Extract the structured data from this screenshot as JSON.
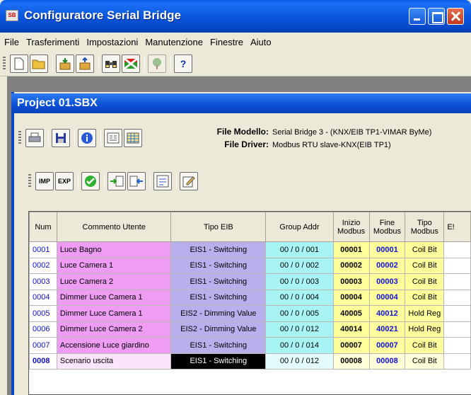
{
  "window": {
    "title": "Configuratore Serial Bridge",
    "app_icon": "SB"
  },
  "menu": [
    "File",
    "Trasferimenti",
    "Impostazioni",
    "Manutenzione",
    "Finestre",
    "Aiuto"
  ],
  "main_toolbar_icons": [
    "new-file-icon",
    "open-folder-icon",
    "download-box-icon",
    "upload-box-icon",
    "binoculars-icon",
    "flag-icon",
    "tree-icon",
    "help-icon"
  ],
  "document": {
    "title": "Project 01.SBX",
    "file_modello_label": "File Modello:",
    "file_modello_value": "Serial Bridge 3 - (KNX/EIB TP1-VIMAR ByMe)",
    "file_driver_label": "File Driver:",
    "file_driver_value": "Modbus RTU slave-KNX(EIB TP1)",
    "op_buttons": {
      "imp": "IMP",
      "exp": "EXP"
    }
  },
  "grid": {
    "columns": [
      "Num",
      "Commento Utente",
      "Tipo EIB",
      "Group Addr",
      "Inizio Modbus",
      "Fine Modbus",
      "Tipo Modbus",
      "E!"
    ],
    "rows": [
      {
        "num": "0001",
        "comment": "Luce Bagno",
        "eib": "EIS1 - Switching",
        "addr": "00 / 0 / 001",
        "start": "00001",
        "end": "00001",
        "tipo": "Coil Bit"
      },
      {
        "num": "0002",
        "comment": "Luce Camera 1",
        "eib": "EIS1 - Switching",
        "addr": "00 / 0 / 002",
        "start": "00002",
        "end": "00002",
        "tipo": "Coil Bit"
      },
      {
        "num": "0003",
        "comment": "Luce Camera 2",
        "eib": "EIS1 - Switching",
        "addr": "00 / 0 / 003",
        "start": "00003",
        "end": "00003",
        "tipo": "Coil Bit"
      },
      {
        "num": "0004",
        "comment": "Dimmer Luce Camera 1",
        "eib": "EIS1 - Switching",
        "addr": "00 / 0 / 004",
        "start": "00004",
        "end": "00004",
        "tipo": "Coil Bit"
      },
      {
        "num": "0005",
        "comment": "Dimmer Luce Camera 1",
        "eib": "EIS2 - Dimming Value",
        "addr": "00 / 0 / 005",
        "start": "40005",
        "end": "40012",
        "tipo": "Hold Reg"
      },
      {
        "num": "0006",
        "comment": "Dimmer Luce Camera 2",
        "eib": "EIS2 - Dimming Value",
        "addr": "00 / 0 / 012",
        "start": "40014",
        "end": "40021",
        "tipo": "Hold Reg"
      },
      {
        "num": "0007",
        "comment": "Accensione Luce giardino",
        "eib": "EIS1 - Switching",
        "addr": "00 / 0 / 014",
        "start": "00007",
        "end": "00007",
        "tipo": "Coil Bit"
      },
      {
        "num": "0008",
        "comment": "Scenario uscita",
        "eib": "EIS1 - Switching",
        "addr": "00 / 0 / 012",
        "start": "00008",
        "end": "00008",
        "tipo": "Coil Bit",
        "selected": true
      }
    ]
  }
}
